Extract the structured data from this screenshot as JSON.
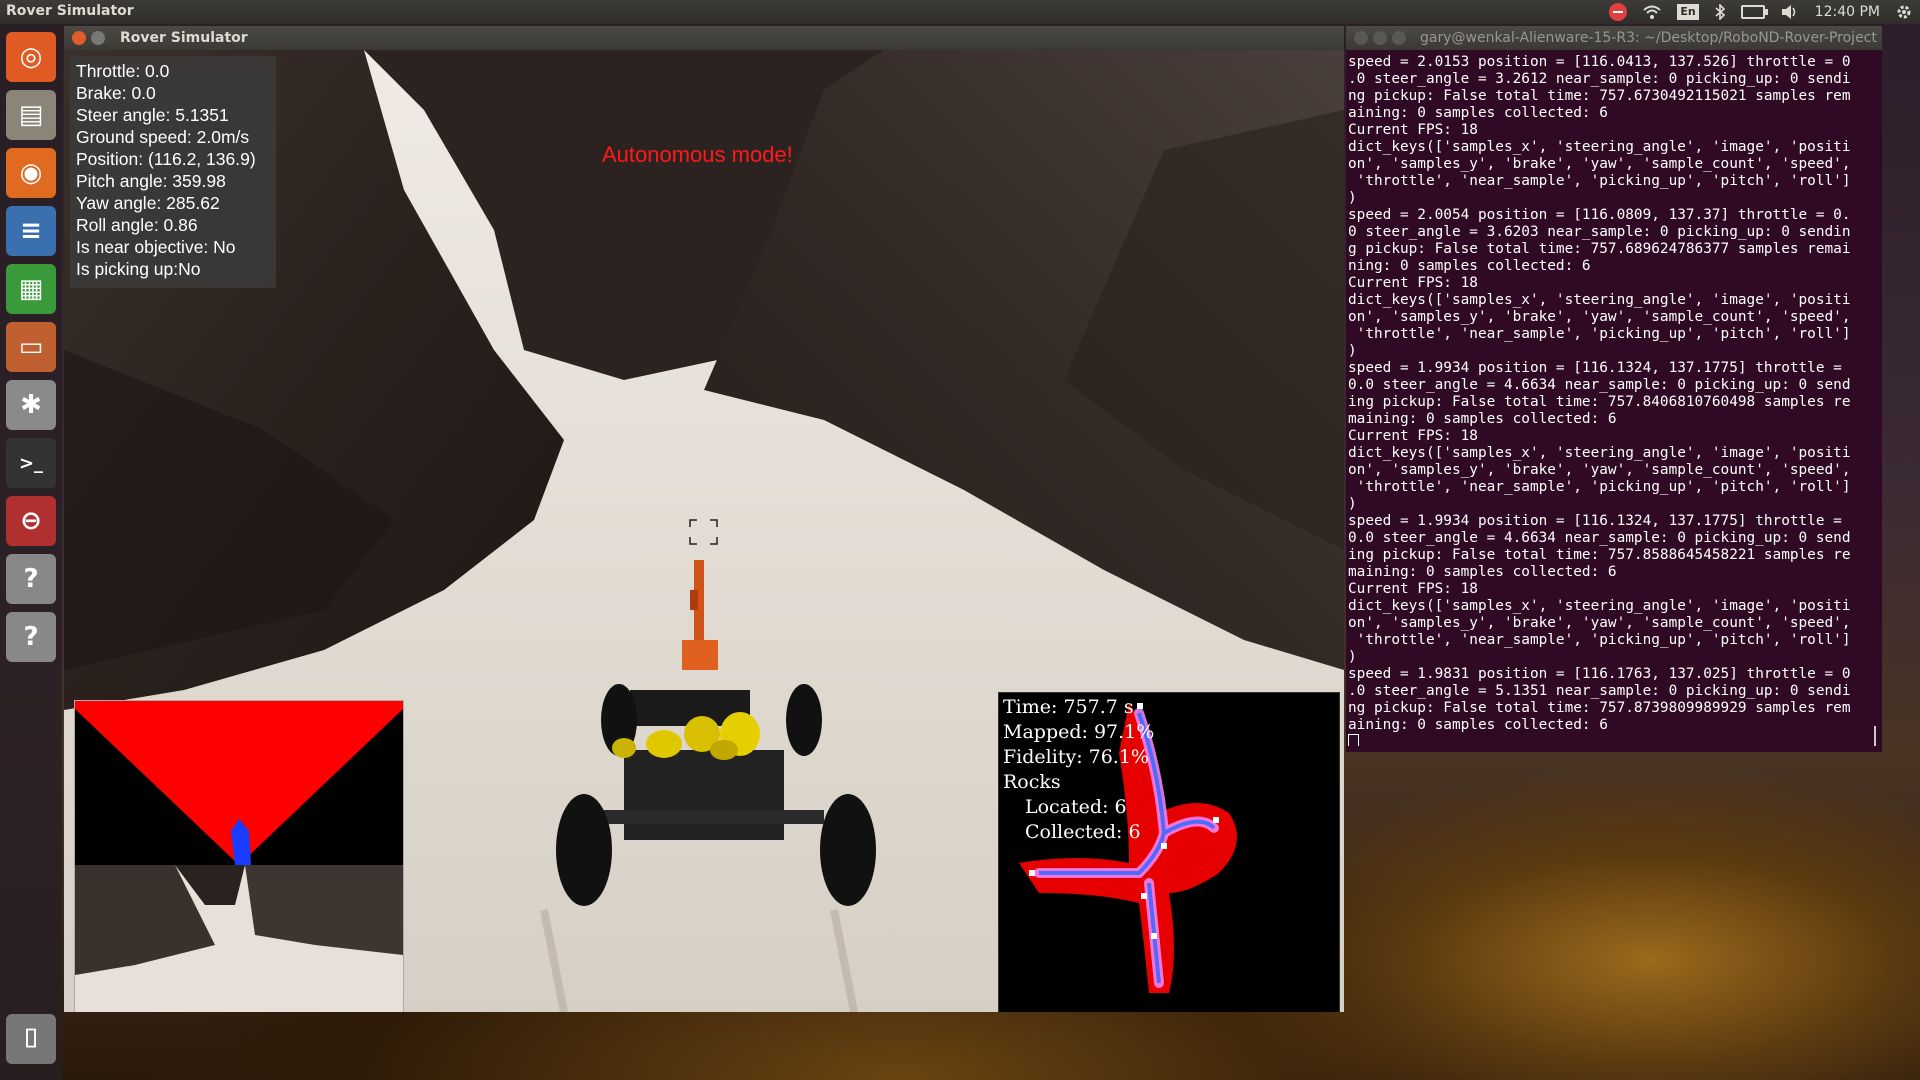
{
  "top_panel": {
    "app_name": "Rover Simulator",
    "keyboard_layout": "En",
    "clock": "12:40 PM",
    "icons": [
      "network-blocked-icon",
      "wifi-icon",
      "keyboard-icon",
      "bluetooth-icon",
      "battery-icon",
      "volume-icon",
      "settings-gear-icon"
    ]
  },
  "launcher": {
    "items": [
      {
        "name": "ubuntu-dash",
        "icon": "ubuntu-logo-icon",
        "color": "#e05a24"
      },
      {
        "name": "files",
        "icon": "file-cabinet-icon",
        "color": "#8a8578"
      },
      {
        "name": "firefox",
        "icon": "firefox-icon",
        "color": "#e06a20"
      },
      {
        "name": "writer",
        "icon": "writer-doc-icon",
        "color": "#3a6fb0"
      },
      {
        "name": "calc",
        "icon": "calc-sheet-icon",
        "color": "#3a9a3a"
      },
      {
        "name": "impress",
        "icon": "impress-slides-icon",
        "color": "#c06030"
      },
      {
        "name": "system-settings",
        "icon": "settings-wrench-icon",
        "color": "#8a8a8a"
      },
      {
        "name": "terminal",
        "icon": "terminal-icon",
        "color": "#333333"
      },
      {
        "name": "unity-app",
        "icon": "red-disk-icon",
        "color": "#b03030"
      },
      {
        "name": "unknown-app-1",
        "icon": "question-icon",
        "color": "#888888"
      },
      {
        "name": "unknown-app-2",
        "icon": "question-icon",
        "color": "#888888"
      },
      {
        "name": "trash",
        "icon": "trash-icon",
        "color": "#777777"
      }
    ]
  },
  "simulator": {
    "window_title": "Rover Simulator",
    "hud": {
      "throttle": "Throttle: 0.0",
      "brake": "Brake: 0.0",
      "steer": "Steer angle: 5.1351",
      "speed": "Ground speed: 2.0m/s",
      "position": "Position: (116.2, 136.9)",
      "pitch": "Pitch angle: 359.98",
      "yaw": "Yaw angle: 285.62",
      "roll": "Roll angle: 0.86",
      "near": "Is near objective: No",
      "picking": "Is picking up:No"
    },
    "mode_message": "Autonomous mode!",
    "world_map": {
      "time": "Time: 757.7 s",
      "mapped": "Mapped: 97.1%",
      "fidelity": "Fidelity: 76.1%",
      "rocks": "Rocks",
      "located": "Located: 6",
      "collected": "Collected: 6"
    },
    "colors": {
      "mode_text": "#ff1a1a",
      "navigable": "#ff0000",
      "rover_marker": "#1a3cff"
    }
  },
  "terminal": {
    "title": "gary@wenkal-Alienware-15-R3: ~/Desktop/RoboND-Rover-Project",
    "lines": [
      "speed = 2.0153 position = [116.0413, 137.526] throttle = 0",
      ".0 steer_angle = 3.2612 near_sample: 0 picking_up: 0 sendi",
      "ng pickup: False total time: 757.6730492115021 samples rem",
      "aining: 0 samples collected: 6",
      "Current FPS: 18",
      "dict_keys(['samples_x', 'steering_angle', 'image', 'positi",
      "on', 'samples_y', 'brake', 'yaw', 'sample_count', 'speed',",
      " 'throttle', 'near_sample', 'picking_up', 'pitch', 'roll']",
      ")",
      "speed = 2.0054 position = [116.0809, 137.37] throttle = 0.",
      "0 steer_angle = 3.6203 near_sample: 0 picking_up: 0 sendin",
      "g pickup: False total time: 757.689624786377 samples remai",
      "ning: 0 samples collected: 6",
      "Current FPS: 18",
      "dict_keys(['samples_x', 'steering_angle', 'image', 'positi",
      "on', 'samples_y', 'brake', 'yaw', 'sample_count', 'speed',",
      " 'throttle', 'near_sample', 'picking_up', 'pitch', 'roll']",
      ")",
      "speed = 1.9934 position = [116.1324, 137.1775] throttle =",
      "0.0 steer_angle = 4.6634 near_sample: 0 picking_up: 0 send",
      "ing pickup: False total time: 757.8406810760498 samples re",
      "maining: 0 samples collected: 6",
      "Current FPS: 18",
      "dict_keys(['samples_x', 'steering_angle', 'image', 'positi",
      "on', 'samples_y', 'brake', 'yaw', 'sample_count', 'speed',",
      " 'throttle', 'near_sample', 'picking_up', 'pitch', 'roll']",
      ")",
      "speed = 1.9934 position = [116.1324, 137.1775] throttle =",
      "0.0 steer_angle = 4.6634 near_sample: 0 picking_up: 0 send",
      "ing pickup: False total time: 757.8588645458221 samples re",
      "maining: 0 samples collected: 6",
      "Current FPS: 18",
      "dict_keys(['samples_x', 'steering_angle', 'image', 'positi",
      "on', 'samples_y', 'brake', 'yaw', 'sample_count', 'speed',",
      " 'throttle', 'near_sample', 'picking_up', 'pitch', 'roll']",
      ")",
      "speed = 1.9831 position = [116.1763, 137.025] throttle = 0",
      ".0 steer_angle = 5.1351 near_sample: 0 picking_up: 0 sendi",
      "ng pickup: False total time: 757.8739809989929 samples rem",
      "aining: 0 samples collected: 6"
    ]
  }
}
